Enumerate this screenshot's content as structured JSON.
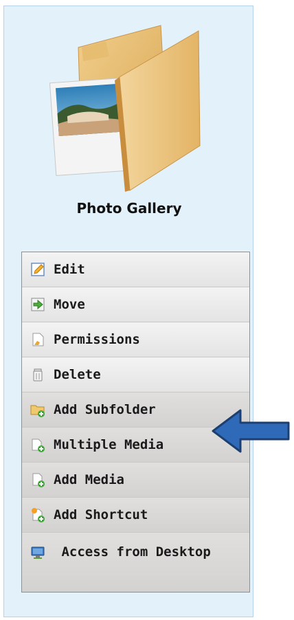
{
  "gallery": {
    "title": "Photo Gallery"
  },
  "menu": {
    "items": [
      {
        "label": "Edit",
        "icon": "edit-icon"
      },
      {
        "label": "Move",
        "icon": "move-icon"
      },
      {
        "label": "Permissions",
        "icon": "permissions-icon"
      },
      {
        "label": "Delete",
        "icon": "trash-icon"
      },
      {
        "label": "Add Subfolder",
        "icon": "add-folder-icon"
      },
      {
        "label": "Multiple Media",
        "icon": "add-media-icon"
      },
      {
        "label": "Add Media",
        "icon": "add-document-icon"
      },
      {
        "label": "Add Shortcut",
        "icon": "add-shortcut-icon"
      },
      {
        "label": "Access from Desktop",
        "icon": "desktop-icon"
      }
    ]
  },
  "colors": {
    "panel_bg": "#e3f1fb",
    "folder": "#e9b866",
    "arrow": "#2f6ab8"
  }
}
